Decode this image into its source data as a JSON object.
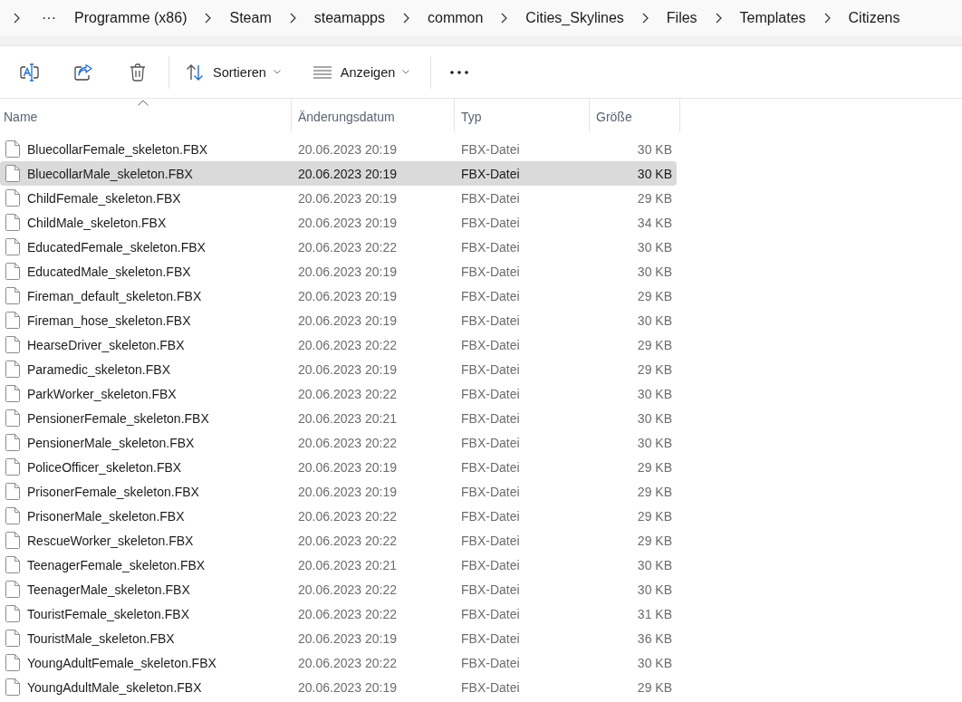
{
  "breadcrumb": {
    "overflow": "···",
    "items": [
      "Programme (x86)",
      "Steam",
      "steamapps",
      "common",
      "Cities_Skylines",
      "Files",
      "Templates",
      "Citizens"
    ]
  },
  "toolbar": {
    "sort_menu": {
      "label": "Sortieren"
    },
    "view_menu": {
      "label": "Anzeigen"
    }
  },
  "table": {
    "columns": [
      {
        "label": "Name",
        "sorted": true
      },
      {
        "label": "Änderungsdatum",
        "sorted": false
      },
      {
        "label": "Typ",
        "sorted": false
      },
      {
        "label": "Größe",
        "sorted": false
      }
    ],
    "rows": [
      {
        "name": "BluecollarFemale_skeleton.FBX",
        "modified": "20.06.2023 20:19",
        "type": "FBX-Datei",
        "size": "30 KB",
        "selected": false
      },
      {
        "name": "BluecollarMale_skeleton.FBX",
        "modified": "20.06.2023 20:19",
        "type": "FBX-Datei",
        "size": "30 KB",
        "selected": true
      },
      {
        "name": "ChildFemale_skeleton.FBX",
        "modified": "20.06.2023 20:19",
        "type": "FBX-Datei",
        "size": "29 KB",
        "selected": false
      },
      {
        "name": "ChildMale_skeleton.FBX",
        "modified": "20.06.2023 20:19",
        "type": "FBX-Datei",
        "size": "34 KB",
        "selected": false
      },
      {
        "name": "EducatedFemale_skeleton.FBX",
        "modified": "20.06.2023 20:22",
        "type": "FBX-Datei",
        "size": "30 KB",
        "selected": false
      },
      {
        "name": "EducatedMale_skeleton.FBX",
        "modified": "20.06.2023 20:19",
        "type": "FBX-Datei",
        "size": "30 KB",
        "selected": false
      },
      {
        "name": "Fireman_default_skeleton.FBX",
        "modified": "20.06.2023 20:19",
        "type": "FBX-Datei",
        "size": "29 KB",
        "selected": false
      },
      {
        "name": "Fireman_hose_skeleton.FBX",
        "modified": "20.06.2023 20:19",
        "type": "FBX-Datei",
        "size": "30 KB",
        "selected": false
      },
      {
        "name": "HearseDriver_skeleton.FBX",
        "modified": "20.06.2023 20:22",
        "type": "FBX-Datei",
        "size": "29 KB",
        "selected": false
      },
      {
        "name": "Paramedic_skeleton.FBX",
        "modified": "20.06.2023 20:19",
        "type": "FBX-Datei",
        "size": "29 KB",
        "selected": false
      },
      {
        "name": "ParkWorker_skeleton.FBX",
        "modified": "20.06.2023 20:22",
        "type": "FBX-Datei",
        "size": "30 KB",
        "selected": false
      },
      {
        "name": "PensionerFemale_skeleton.FBX",
        "modified": "20.06.2023 20:21",
        "type": "FBX-Datei",
        "size": "30 KB",
        "selected": false
      },
      {
        "name": "PensionerMale_skeleton.FBX",
        "modified": "20.06.2023 20:22",
        "type": "FBX-Datei",
        "size": "30 KB",
        "selected": false
      },
      {
        "name": "PoliceOfficer_skeleton.FBX",
        "modified": "20.06.2023 20:19",
        "type": "FBX-Datei",
        "size": "29 KB",
        "selected": false
      },
      {
        "name": "PrisonerFemale_skeleton.FBX",
        "modified": "20.06.2023 20:19",
        "type": "FBX-Datei",
        "size": "29 KB",
        "selected": false
      },
      {
        "name": "PrisonerMale_skeleton.FBX",
        "modified": "20.06.2023 20:22",
        "type": "FBX-Datei",
        "size": "29 KB",
        "selected": false
      },
      {
        "name": "RescueWorker_skeleton.FBX",
        "modified": "20.06.2023 20:22",
        "type": "FBX-Datei",
        "size": "29 KB",
        "selected": false
      },
      {
        "name": "TeenagerFemale_skeleton.FBX",
        "modified": "20.06.2023 20:21",
        "type": "FBX-Datei",
        "size": "30 KB",
        "selected": false
      },
      {
        "name": "TeenagerMale_skeleton.FBX",
        "modified": "20.06.2023 20:22",
        "type": "FBX-Datei",
        "size": "30 KB",
        "selected": false
      },
      {
        "name": "TouristFemale_skeleton.FBX",
        "modified": "20.06.2023 20:22",
        "type": "FBX-Datei",
        "size": "31 KB",
        "selected": false
      },
      {
        "name": "TouristMale_skeleton.FBX",
        "modified": "20.06.2023 20:19",
        "type": "FBX-Datei",
        "size": "36 KB",
        "selected": false
      },
      {
        "name": "YoungAdultFemale_skeleton.FBX",
        "modified": "20.06.2023 20:22",
        "type": "FBX-Datei",
        "size": "30 KB",
        "selected": false
      },
      {
        "name": "YoungAdultMale_skeleton.FBX",
        "modified": "20.06.2023 20:19",
        "type": "FBX-Datei",
        "size": "29 KB",
        "selected": false
      }
    ]
  }
}
